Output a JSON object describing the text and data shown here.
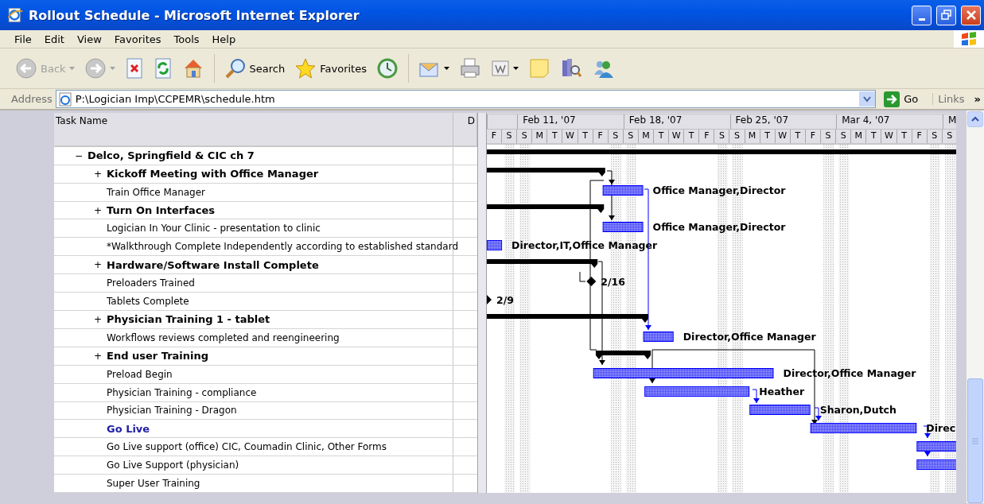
{
  "window": {
    "title": "Rollout Schedule - Microsoft Internet Explorer"
  },
  "menu": [
    "File",
    "Edit",
    "View",
    "Favorites",
    "Tools",
    "Help"
  ],
  "toolbar": {
    "back": {
      "label": "Back",
      "disabled": true
    },
    "search": {
      "label": "Search"
    },
    "favorites": {
      "label": "Favorites"
    }
  },
  "address": {
    "label": "Address",
    "value": "P:\\Logician Imp\\CCPEMR\\schedule.htm",
    "go": "Go",
    "links": "Links",
    "more": "»"
  },
  "table": {
    "columns": [
      "Task Name",
      "D"
    ],
    "timeline": {
      "weeks": [
        "Feb 11, '07",
        "Feb 18, '07",
        "Feb 25, '07",
        "Mar 4, '07",
        "M"
      ],
      "days": [
        {
          "letter": "F",
          "weekend": false
        },
        {
          "letter": "S",
          "weekend": true
        },
        {
          "letter": "S",
          "weekend": true
        },
        {
          "letter": "M",
          "weekend": false
        },
        {
          "letter": "T",
          "weekend": false
        },
        {
          "letter": "W",
          "weekend": false
        },
        {
          "letter": "T",
          "weekend": false
        },
        {
          "letter": "F",
          "weekend": false
        },
        {
          "letter": "S",
          "weekend": true
        },
        {
          "letter": "S",
          "weekend": true
        },
        {
          "letter": "M",
          "weekend": false
        },
        {
          "letter": "T",
          "weekend": false
        },
        {
          "letter": "W",
          "weekend": false
        },
        {
          "letter": "T",
          "weekend": false
        },
        {
          "letter": "F",
          "weekend": false
        },
        {
          "letter": "S",
          "weekend": true
        },
        {
          "letter": "S",
          "weekend": true
        },
        {
          "letter": "M",
          "weekend": false
        },
        {
          "letter": "T",
          "weekend": false
        },
        {
          "letter": "W",
          "weekend": false
        },
        {
          "letter": "T",
          "weekend": false
        },
        {
          "letter": "F",
          "weekend": false
        },
        {
          "letter": "S",
          "weekend": true
        },
        {
          "letter": "S",
          "weekend": true
        },
        {
          "letter": "M",
          "weekend": false
        },
        {
          "letter": "T",
          "weekend": false
        },
        {
          "letter": "W",
          "weekend": false
        },
        {
          "letter": "T",
          "weekend": false
        },
        {
          "letter": "F",
          "weekend": false
        },
        {
          "letter": "S",
          "weekend": true
        },
        {
          "letter": "S",
          "weekend": true
        }
      ]
    },
    "tasks": [
      {
        "name": "Delco, Springfield & CIC ch  7",
        "kind": "summary",
        "toggle": "−",
        "bar": {
          "kind": "summary"
        },
        "children": [
          {
            "name": "Kickoff Meeting with Office Manager",
            "kind": "summary",
            "toggle": "+",
            "bar": {
              "kind": "summary"
            }
          },
          {
            "name": "Train Office Manager",
            "kind": "task",
            "bar": {
              "kind": "task",
              "label": "Office Manager,Director"
            }
          },
          {
            "name": "Turn On Interfaces",
            "kind": "summary",
            "toggle": "+",
            "bar": {
              "kind": "summary"
            }
          },
          {
            "name": "Logician In  Your Clinic - presentation to clinic",
            "kind": "task",
            "bar": {
              "kind": "task",
              "label": "Office Manager,Director"
            }
          },
          {
            "name": "*Walkthrough Complete Independently according to established standard",
            "kind": "task",
            "bar": {
              "kind": "task",
              "label": "Director,IT,Office Manager"
            }
          },
          {
            "name": "Hardware/Software Install Complete",
            "kind": "summary",
            "toggle": "+",
            "bar": {
              "kind": "summary"
            }
          },
          {
            "name": "Preloaders Trained",
            "kind": "task",
            "bar": {
              "kind": "milestone",
              "label": "2/16"
            }
          },
          {
            "name": "Tablets Complete",
            "kind": "task",
            "bar": {
              "kind": "milestone",
              "label": "2/9"
            }
          },
          {
            "name": "Physician Training 1 - tablet",
            "kind": "summary",
            "toggle": "+",
            "bar": {
              "kind": "summary"
            }
          },
          {
            "name": "Workflows reviews completed and reengineering",
            "kind": "task",
            "bar": {
              "kind": "task",
              "label": "Director,Office Manager"
            }
          },
          {
            "name": "End user Training",
            "kind": "summary",
            "toggle": "+",
            "bar": {
              "kind": "summary"
            }
          },
          {
            "name": "Preload Begin",
            "kind": "task",
            "bar": {
              "kind": "task",
              "label": "Director,Office Manager"
            }
          },
          {
            "name": "Physician Training  - compliance",
            "kind": "task",
            "bar": {
              "kind": "task",
              "label": "Heather"
            }
          },
          {
            "name": "Physician Training  - Dragon",
            "kind": "task",
            "bar": {
              "kind": "task",
              "label": "Sharon,Dutch"
            }
          },
          {
            "name": "Go Live",
            "kind": "highlight",
            "bar": {
              "kind": "task",
              "label": "Direc"
            }
          },
          {
            "name": "Go Live support (office) CIC, Coumadin Clinic, Other Forms",
            "kind": "task",
            "bar": {
              "kind": "task"
            }
          },
          {
            "name": "Go Live Support (physician)",
            "kind": "task",
            "bar": {
              "kind": "task"
            }
          },
          {
            "name": "Super User Training",
            "kind": "task"
          }
        ]
      }
    ]
  }
}
